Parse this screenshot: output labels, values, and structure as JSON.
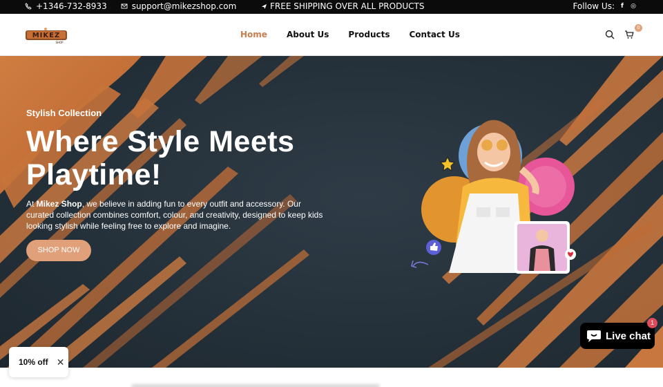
{
  "topbar": {
    "phone": "+1346-732-8933",
    "email": "support@mikezshop.com",
    "shipping": "FREE SHIPPING OVER ALL PRODUCTS",
    "follow": "Follow Us:",
    "social": [
      "f",
      "◎"
    ]
  },
  "header": {
    "logo_text": "MIKEZ",
    "logo_sub": "SHOP",
    "nav": [
      "Home",
      "About Us",
      "Products",
      "Contact Us"
    ],
    "active_nav": "Home",
    "cart_count": "0"
  },
  "hero": {
    "subtitle": "Stylish Collection",
    "title": "Where Style Meets Playtime!",
    "desc_prefix": "At ",
    "desc_brand": "Mikez Shop",
    "desc_rest": ", we believe in adding fun to every outfit and accessory. Our curated collection combines comfort, colour, and creativity, designed to keep kids looking stylish while feeling free to explore and imagine.",
    "button": "SHOP NOW"
  },
  "discount": {
    "label": "10% off",
    "close": "✕"
  },
  "livechat": {
    "label": "Live chat",
    "badge": "1"
  },
  "colors": {
    "accent": "#c97d4c",
    "button": "#e0a17a",
    "hero_bg": "#243039",
    "stroke": "#c8733d"
  }
}
